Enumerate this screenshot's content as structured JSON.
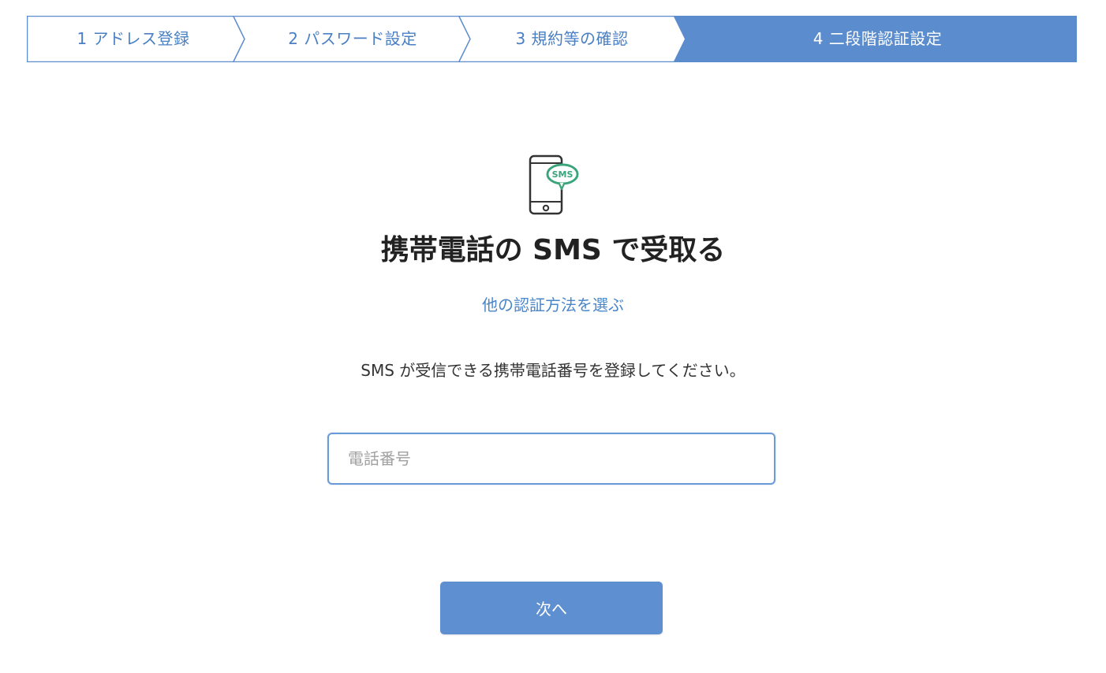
{
  "stepper": {
    "steps": [
      {
        "label": "1 アドレス登録",
        "active": false
      },
      {
        "label": "2 パスワード設定",
        "active": false
      },
      {
        "label": "3 規約等の確認",
        "active": false
      },
      {
        "label": "4 二段階認証設定",
        "active": true
      }
    ],
    "colors": {
      "active_fill": "#5b8ccd",
      "border": "#5b8ccd",
      "inactive_text": "#4a7fc4"
    }
  },
  "main": {
    "icon": "phone-sms-icon",
    "icon_badge_text": "SMS",
    "title": "携帯電話の SMS で受取る",
    "other_method_link": "他の認証方法を選ぶ",
    "instruction": "SMS が受信できる携帯電話番号を登録してください。",
    "phone_input": {
      "value": "",
      "placeholder": "電話番号"
    },
    "next_button_label": "次へ"
  },
  "colors": {
    "accent": "#5e8fd0",
    "link": "#4a86c8",
    "sms_badge": "#3aa57a"
  }
}
